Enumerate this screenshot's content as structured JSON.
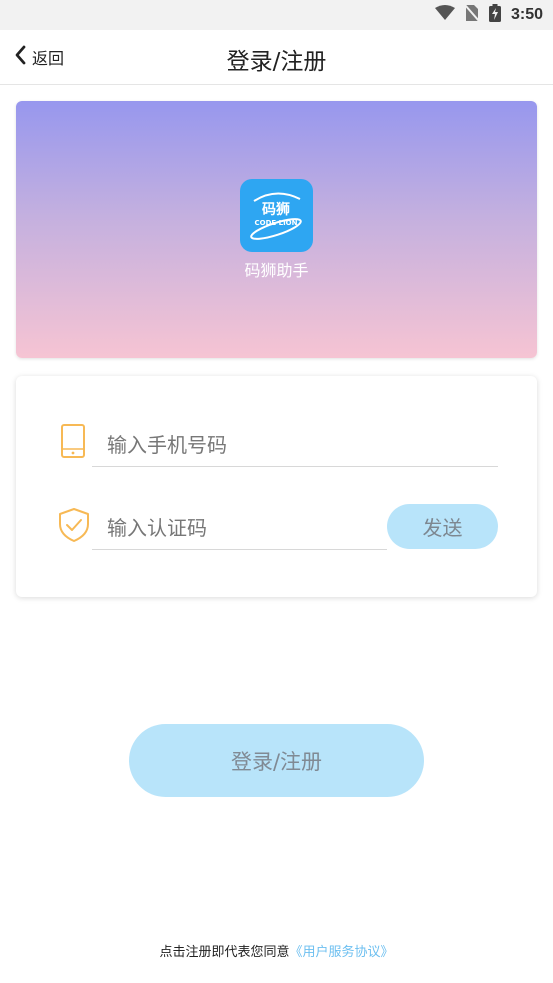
{
  "status_bar": {
    "time": "3:50",
    "icons": [
      "wifi-icon",
      "no-sim-icon",
      "battery-charging-icon"
    ]
  },
  "header": {
    "back_label": "返回",
    "title": "登录/注册"
  },
  "banner": {
    "logo_text_top": "码狮",
    "logo_text_bottom": "CODE LION",
    "app_name": "码狮助手"
  },
  "form": {
    "phone_placeholder": "输入手机号码",
    "phone_value": "",
    "code_placeholder": "输入认证码",
    "code_value": "",
    "send_label": "发送"
  },
  "submit_label": "登录/注册",
  "agreement": {
    "prefix": "点击注册即代表您同意",
    "link": "《用户服务协议》"
  },
  "colors": {
    "accent_light_blue": "#b8e4fa",
    "icon_orange": "#f7b955",
    "link_blue": "#6cbff0",
    "logo_blue": "#2ea6f2"
  }
}
